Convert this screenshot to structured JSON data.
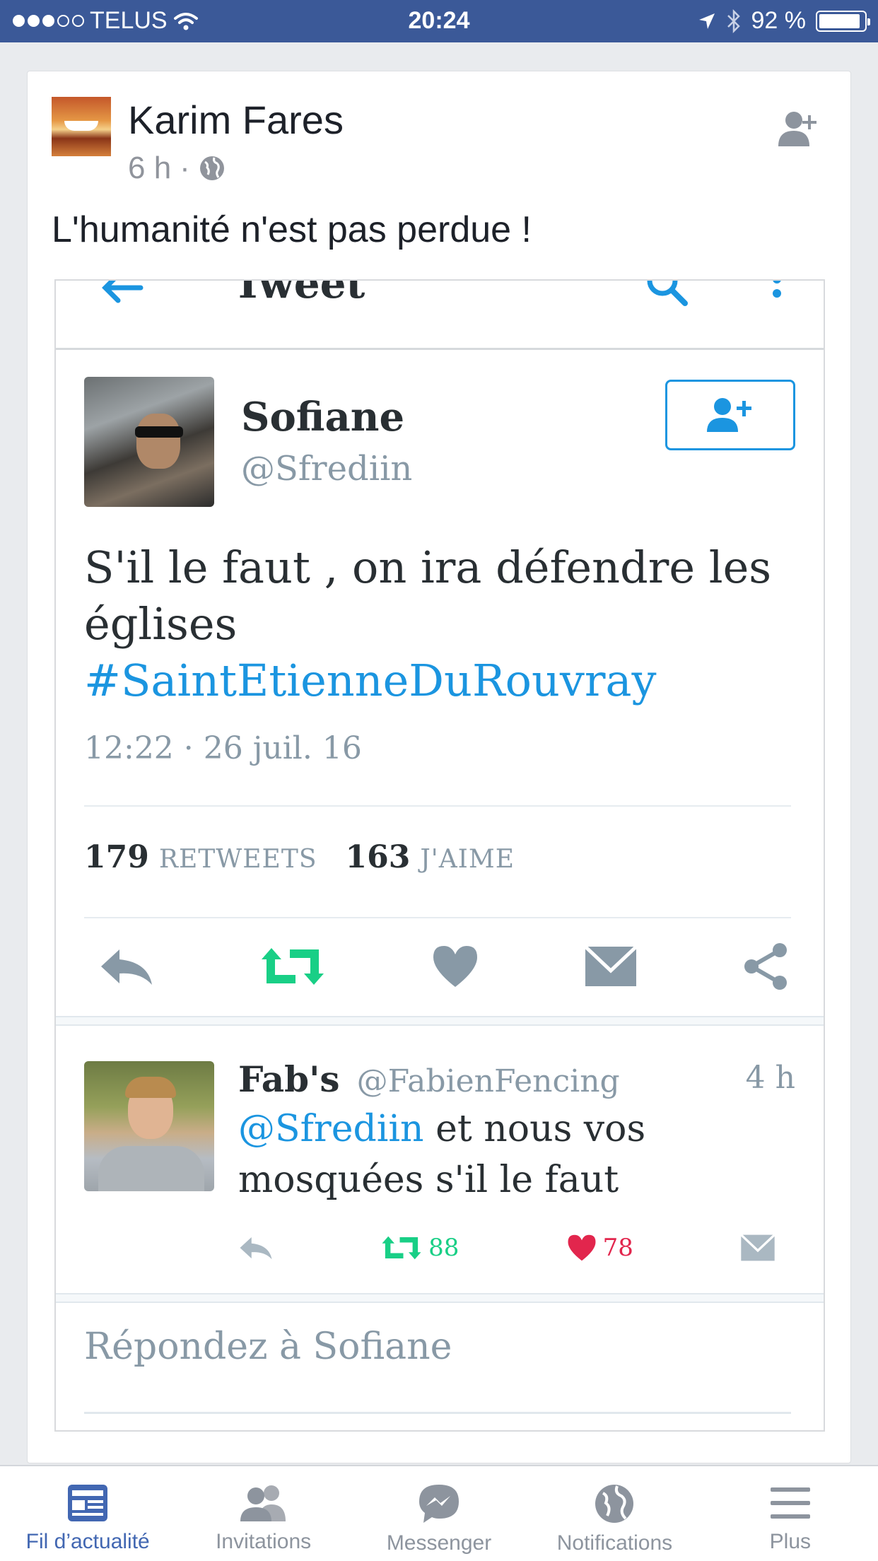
{
  "status_bar": {
    "carrier": "TELUS",
    "time": "20:24",
    "battery": "92 %",
    "battery_level": 0.92,
    "signal_bars": 3
  },
  "post": {
    "author": "Karim Fares",
    "time": "6 h",
    "separator": "·",
    "privacy_icon": "globe-icon",
    "text": "L'humanité n'est pas perdue !",
    "add_friend_icon": "add-friend-icon"
  },
  "embedded_tweet": {
    "header_title": "Tweet",
    "author_name": "Sofiane",
    "author_handle": "@Sfrediin",
    "text": "S'il le faut , on ira défendre les églises",
    "hashtag": "#SaintEtienneDuRouvray",
    "timestamp": "12:22 · 26 juil. 16",
    "retweets_count": "179",
    "retweets_label": "RETWEETS",
    "likes_count": "163",
    "likes_label": "J'AIME",
    "accent_color": "#1b95e0",
    "retweet_color": "#19cf86",
    "like_color": "#e2264d"
  },
  "reply": {
    "author_name": "Fab's",
    "author_handle": "@FabienFencing",
    "time": "4 h",
    "mention": "@Sfrediin",
    "text": " et nous vos mosquées s'il le faut",
    "retweets": "88",
    "likes": "78"
  },
  "reply_box": {
    "placeholder": "Répondez à Sofiane"
  },
  "tab_bar": {
    "items": [
      {
        "label": "Fil d’actualité",
        "icon": "news-feed-icon",
        "active": true
      },
      {
        "label": "Invitations",
        "icon": "friends-icon",
        "active": false
      },
      {
        "label": "Messenger",
        "icon": "messenger-icon",
        "active": false
      },
      {
        "label": "Notifications",
        "icon": "globe-icon",
        "active": false
      },
      {
        "label": "Plus",
        "icon": "menu-icon",
        "active": false
      }
    ]
  }
}
